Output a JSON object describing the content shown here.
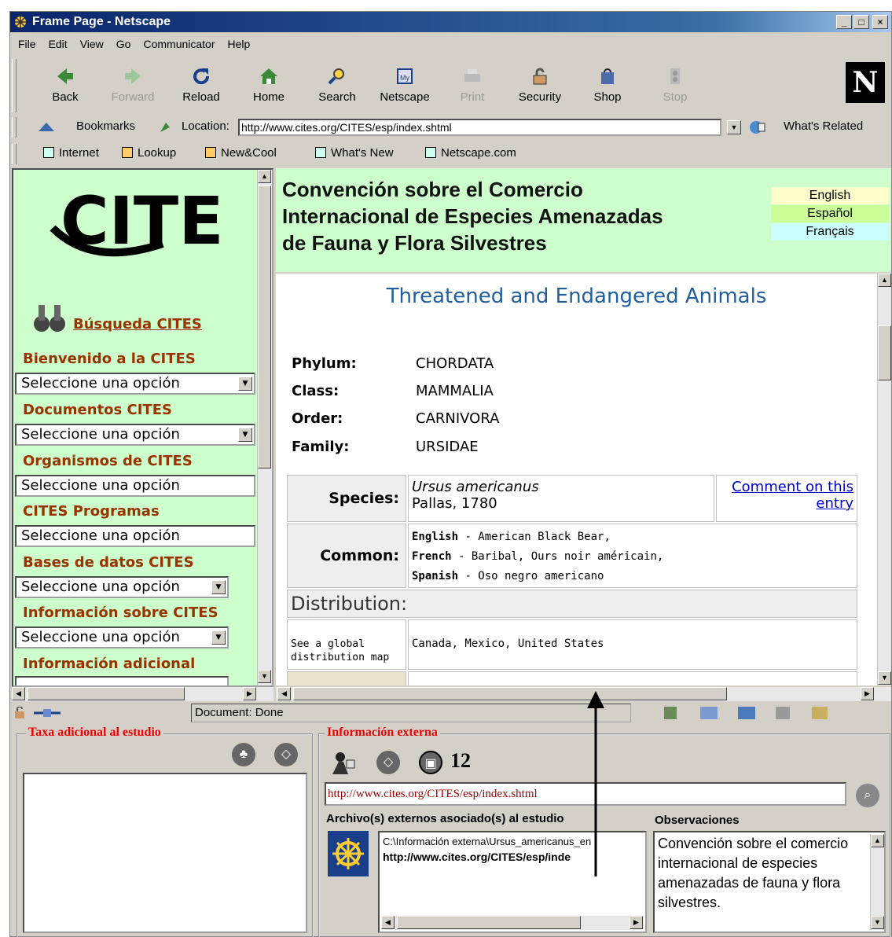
{
  "window": {
    "title": "Frame Page - Netscape",
    "min": "_",
    "max": "□",
    "close": "×"
  },
  "menu": [
    "File",
    "Edit",
    "View",
    "Go",
    "Communicator",
    "Help"
  ],
  "toolbar": {
    "back": "Back",
    "forward": "Forward",
    "reload": "Reload",
    "home": "Home",
    "search": "Search",
    "netscape": "Netscape",
    "print": "Print",
    "security": "Security",
    "shop": "Shop",
    "stop": "Stop",
    "logo": "N"
  },
  "location": {
    "bookmarks": "Bookmarks",
    "label": "Location:",
    "url": "http://www.cites.org/CITES/esp/index.shtml",
    "related": "What's Related"
  },
  "personal": [
    "Internet",
    "Lookup",
    "New&Cool",
    "What's New",
    "Netscape.com"
  ],
  "left": {
    "search_link": "Búsqueda CITES",
    "sections": [
      {
        "heading": "Bienvenido a la CITES",
        "select": "Seleccione una opción"
      },
      {
        "heading": "Documentos CITES",
        "select": "Seleccione una opción"
      },
      {
        "heading": "Organismos de CITES",
        "select": "Seleccione una opción"
      },
      {
        "heading": "CITES Programas",
        "select": "Seleccione una opción"
      },
      {
        "heading": "Bases de datos CITES",
        "select": "Seleccione una opción"
      },
      {
        "heading": "Información sobre CITES",
        "select": "Seleccione una opción"
      },
      {
        "heading": "Información adicional",
        "select": ""
      }
    ]
  },
  "header": {
    "title_line1": "Convención sobre el Comercio",
    "title_line2": "Internacional de Especies Amenazadas",
    "title_line3": "de Fauna y Flora Silvestres",
    "lang_en": "English",
    "lang_es": "Español",
    "lang_fr": "Français"
  },
  "main": {
    "title": "Threatened and Endangered Animals",
    "phylum_label": "Phylum:",
    "phylum": "CHORDATA",
    "class_label": "Class:",
    "class": "MAMMALIA",
    "order_label": "Order:",
    "order": "CARNIVORA",
    "family_label": "Family:",
    "family": "URSIDAE",
    "species_label": "Species:",
    "species_name": "Ursus americanus",
    "species_author": "Pallas, 1780",
    "comment_line1": "Comment on this",
    "comment_line2": "entry",
    "common_label": "Common:",
    "english_label": "English",
    "english": " - American Black Bear,",
    "french_label": "French",
    "french": " - Baribal, Ours noir américain,",
    "spanish_label": "Spanish",
    "spanish": " - Oso negro americano",
    "distribution_label": "Distribution:",
    "map_link_line1": "See a global",
    "map_link_line2": "distribution map",
    "distribution": "Canada, Mexico, United States"
  },
  "status": {
    "text": "Document: Done"
  },
  "bottom": {
    "taxa_title": "Taxa adicional al estudio",
    "external_title": "Información externa",
    "callout": "12",
    "url": "http://www.cites.org/CITES/esp/index.shtml",
    "files_label": "Archivo(s) externos asociado(s) al estudio",
    "file_path": "C:\\Información externa\\Ursus_americanus_en",
    "file_url": "http://www.cites.org/CITES/esp/inde",
    "obs_label": "Observaciones",
    "obs_text": "Convención sobre el comercio internacional de especies amenazadas de fauna y flora silvestres."
  }
}
